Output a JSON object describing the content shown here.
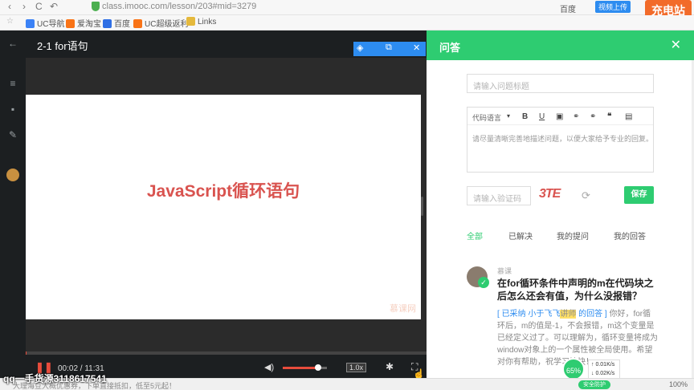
{
  "browser": {
    "url": "class.imooc.com/lesson/203#mid=3279",
    "nav_back": "‹",
    "nav_forward": "›",
    "nav_reload": "C",
    "nav_undo": "↶",
    "right_text": "百度",
    "upload_label": "视频上传",
    "charge_badge": "充电站",
    "bookmarks": [
      {
        "label": "UC导航",
        "color": "#3b82f6"
      },
      {
        "label": "爱淘宝",
        "color": "#f97316"
      },
      {
        "label": "百度",
        "color": "#2f6fe5"
      },
      {
        "label": "UC超级返利",
        "color": "#f97316"
      },
      {
        "label": "Links",
        "color": "#e5b93c"
      }
    ]
  },
  "video": {
    "title": "2-1 for语句",
    "slide_heading": "JavaScript循环语句",
    "slide_watermark": "慕课网",
    "time": "00:02 / 11:31",
    "rate": "1.0x",
    "progress": 0.003,
    "volume": 0.8
  },
  "qa": {
    "header": "问答",
    "title_placeholder": "请输入问题标题",
    "code_lang": "代码语言",
    "toolbar": [
      "B",
      "U",
      "▣",
      "⚭",
      "⚭",
      "❝",
      "▤"
    ],
    "body_placeholder": "请尽量清晰完善地描述问题，以便大家给予专业的回复。",
    "captcha_placeholder": "请输入验证码",
    "captcha_text": "3TE",
    "save_label": "保存",
    "tabs": [
      "全部",
      "已解决",
      "我的提问",
      "我的回答"
    ],
    "question": {
      "user": "慕课",
      "title": "在for循环条件中声明的m在代码块之后怎么还会有值，为什么没报错？",
      "adopted_prefix": "[ 已采纳 ",
      "adopter": "小于飞飞",
      "adopter_badge": "讲师",
      "adopted_suffix": " 的回答 ]",
      "answer": " 你好，for循环后，m的值是-1，不会报错，m这个变量是已经定义过了。可以理解为，循环变量将成为window对象上的一个属性被全局使用。希望对你有帮助，祝学习愉快！"
    }
  },
  "overlay": {
    "speed_percent": "65%",
    "speed_up": "0.01K/s",
    "speed_down": "0.02K/s",
    "status_text": "大理海豆大概优惠券，下单直接抵扣，低至5元起！",
    "zoom": "100%",
    "qq_watermark": "qq一手货源3118617541",
    "mini_badge": "安全防护"
  }
}
